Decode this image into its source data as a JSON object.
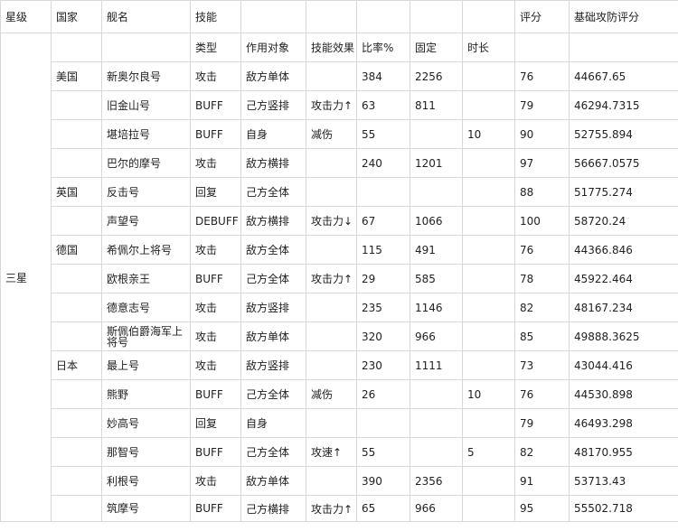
{
  "headers": {
    "star": "星级",
    "country": "国家",
    "ship": "舰名",
    "skill": "技能",
    "rating": "评分",
    "base_score": "基础攻防评分"
  },
  "subheaders": {
    "type": "类型",
    "target": "作用对象",
    "effect": "技能效果",
    "ratio": "比率%",
    "fixed": "固定",
    "duration": "时长"
  },
  "star_level": "三星",
  "countries": [
    {
      "name": "美国",
      "ships": [
        {
          "name": "新奥尔良号",
          "type": "攻击",
          "target": "敌方单体",
          "effect": "",
          "ratio": "384",
          "fixed": "2256",
          "duration": "",
          "rating": "76",
          "score": "44667.65"
        },
        {
          "name": "旧金山号",
          "type": "BUFF",
          "target": "己方竖排",
          "effect": "攻击力↑",
          "ratio": "63",
          "fixed": "811",
          "duration": "",
          "rating": "79",
          "score": "46294.7315"
        },
        {
          "name": "堪培拉号",
          "type": "BUFF",
          "target": "自身",
          "effect": "减伤",
          "ratio": "55",
          "fixed": "",
          "duration": "10",
          "rating": "90",
          "score": "52755.894"
        },
        {
          "name": "巴尔的摩号",
          "type": "攻击",
          "target": "敌方横排",
          "effect": "",
          "ratio": "240",
          "fixed": "1201",
          "duration": "",
          "rating": "97",
          "score": "56667.0575"
        }
      ]
    },
    {
      "name": "英国",
      "ships": [
        {
          "name": "反击号",
          "type": "回复",
          "target": "己方全体",
          "effect": "",
          "ratio": "",
          "fixed": "",
          "duration": "",
          "rating": "88",
          "score": "51775.274"
        },
        {
          "name": "声望号",
          "type": "DEBUFF",
          "target": "敌方横排",
          "effect": "攻击力↓",
          "ratio": "67",
          "fixed": "1066",
          "duration": "",
          "rating": "100",
          "score": "58720.24"
        }
      ]
    },
    {
      "name": "德国",
      "ships": [
        {
          "name": "希佩尔上将号",
          "type": "攻击",
          "target": "敌方全体",
          "effect": "",
          "ratio": "115",
          "fixed": "491",
          "duration": "",
          "rating": "76",
          "score": "44366.846"
        },
        {
          "name": "欧根亲王",
          "type": "BUFF",
          "target": "己方全体",
          "effect": "攻击力↑",
          "ratio": "29",
          "fixed": "585",
          "duration": "",
          "rating": "78",
          "score": "45922.464"
        },
        {
          "name": "德意志号",
          "type": "攻击",
          "target": "敌方竖排",
          "effect": "",
          "ratio": "235",
          "fixed": "1146",
          "duration": "",
          "rating": "82",
          "score": "48167.234"
        },
        {
          "name": "斯佩伯爵海军上将号",
          "type": "攻击",
          "target": "敌方单体",
          "effect": "",
          "ratio": "320",
          "fixed": "966",
          "duration": "",
          "rating": "85",
          "score": "49888.3625"
        }
      ]
    },
    {
      "name": "日本",
      "ships": [
        {
          "name": "最上号",
          "type": "攻击",
          "target": "敌方竖排",
          "effect": "",
          "ratio": "230",
          "fixed": "1111",
          "duration": "",
          "rating": "73",
          "score": "43044.416"
        },
        {
          "name": "熊野",
          "type": "BUFF",
          "target": "己方全体",
          "effect": "减伤",
          "ratio": "26",
          "fixed": "",
          "duration": "10",
          "rating": "76",
          "score": "44530.898"
        },
        {
          "name": "妙高号",
          "type": "回复",
          "target": "自身",
          "effect": "",
          "ratio": "",
          "fixed": "",
          "duration": "",
          "rating": "79",
          "score": "46493.298"
        },
        {
          "name": "那智号",
          "type": "BUFF",
          "target": "己方全体",
          "effect": "攻速↑",
          "ratio": "55",
          "fixed": "",
          "duration": "5",
          "rating": "82",
          "score": "48170.955"
        },
        {
          "name": "利根号",
          "type": "攻击",
          "target": "敌方单体",
          "effect": "",
          "ratio": "390",
          "fixed": "2356",
          "duration": "",
          "rating": "91",
          "score": "53713.43"
        },
        {
          "name": "筑摩号",
          "type": "BUFF",
          "target": "己方横排",
          "effect": "攻击力↑",
          "ratio": "65",
          "fixed": "966",
          "duration": "",
          "rating": "95",
          "score": "55502.718"
        }
      ]
    }
  ]
}
